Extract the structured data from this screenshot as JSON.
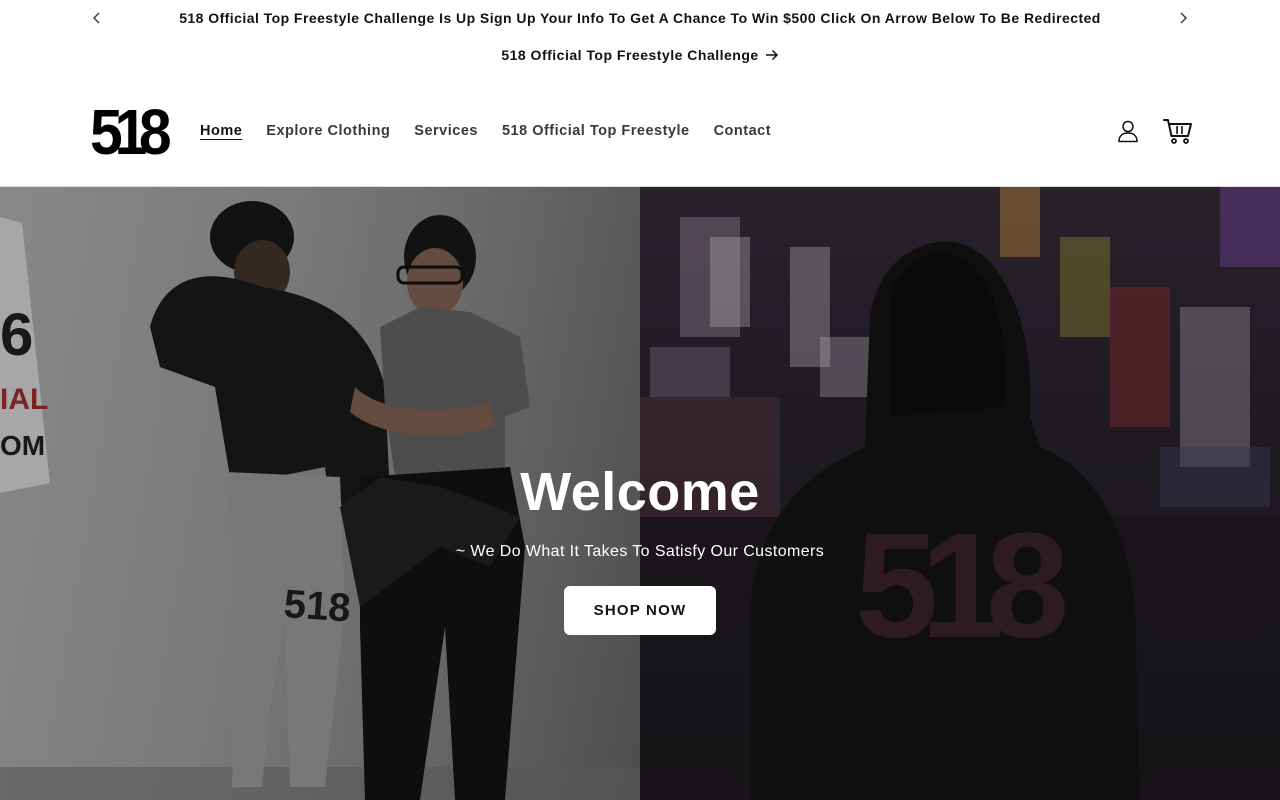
{
  "announcement": {
    "text": "518 Official Top Freestyle Challenge Is Up Sign Up Your Info To Get A Chance To Win $500 Click On Arrow Below To Be Redirected",
    "link_label": "518 Official Top Freestyle Challenge",
    "prev_icon": "chevron-left-icon",
    "next_icon": "chevron-right-icon"
  },
  "header": {
    "logo_text": "518",
    "nav": [
      {
        "label": "Home",
        "active": true
      },
      {
        "label": "Explore Clothing",
        "active": false
      },
      {
        "label": "Services",
        "active": false
      },
      {
        "label": "518 Official Top Freestyle",
        "active": false
      },
      {
        "label": "Contact",
        "active": false
      }
    ],
    "account_icon": "user-icon",
    "cart_icon": "cart-icon"
  },
  "hero": {
    "title": "Welcome",
    "subtitle": "~ We Do What It Takes To Satisfy Our Customers",
    "button_label": "SHOP NOW",
    "left_image": "two people in black and grey 518 clothing leaning on a wall",
    "right_image": "person in black 518 hoodie on a city street at night"
  },
  "colors": {
    "text": "#121212",
    "background": "#ffffff",
    "button_bg": "#ffffff"
  }
}
